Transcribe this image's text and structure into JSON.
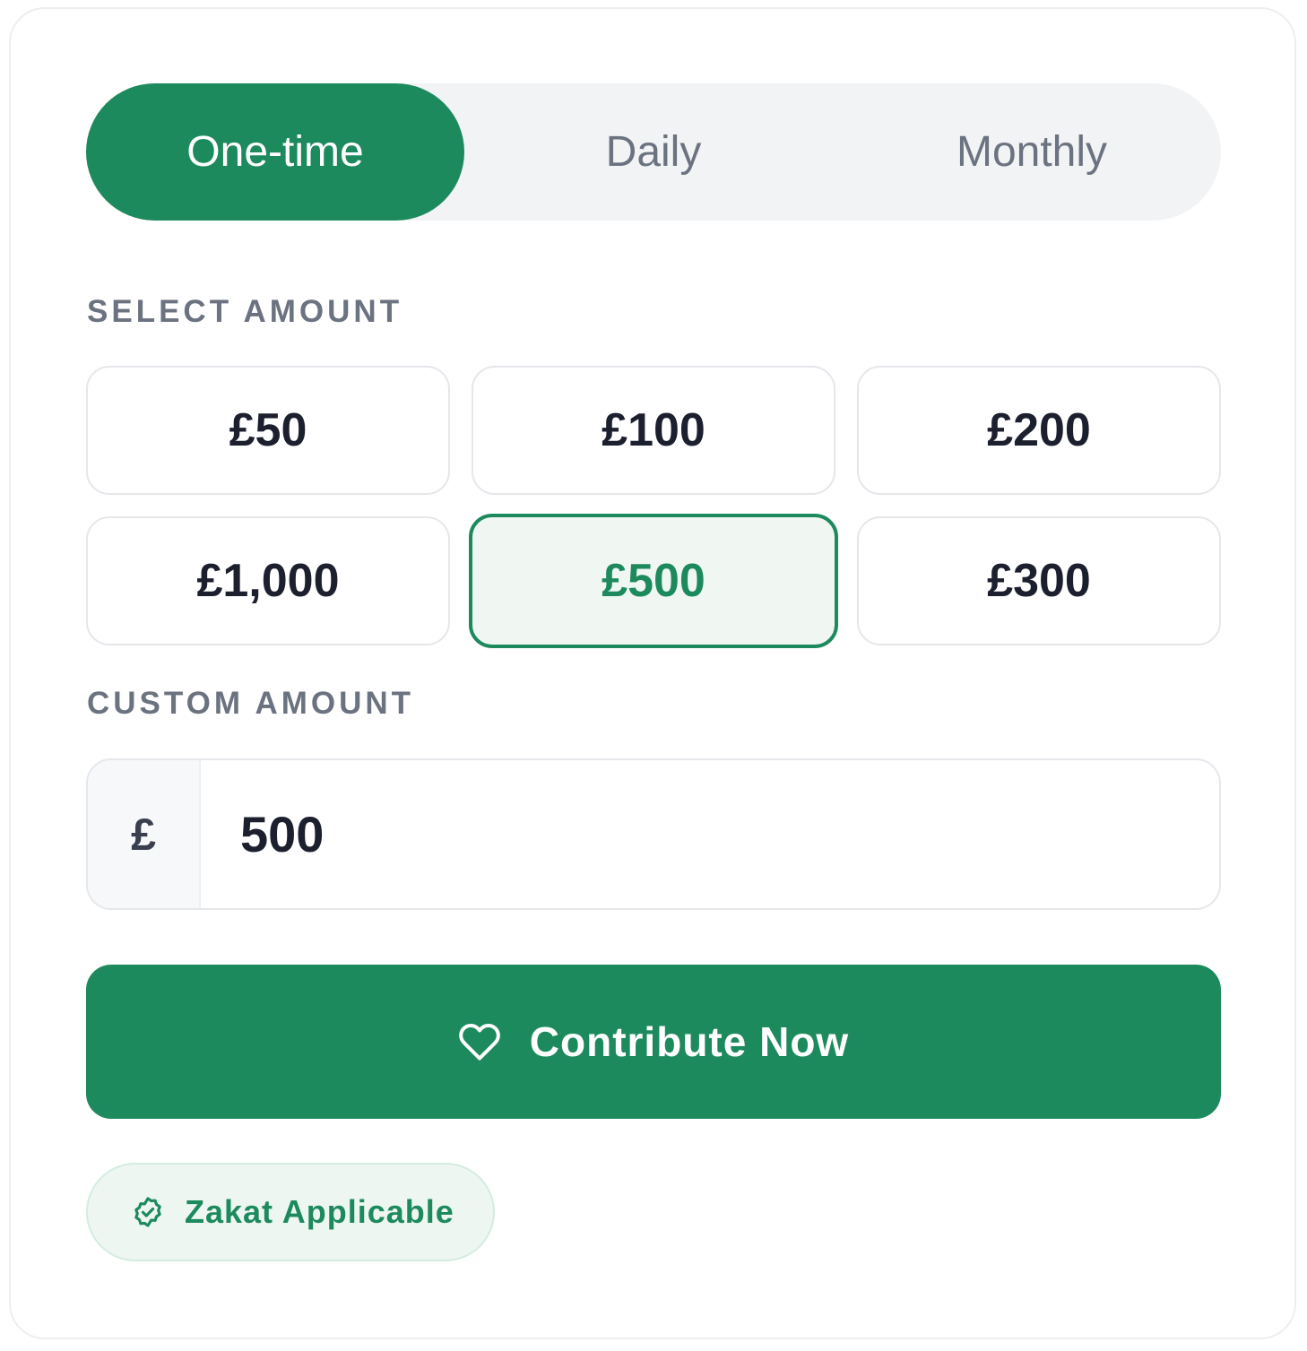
{
  "frequency": {
    "tabs": [
      {
        "label": "One-time",
        "active": true
      },
      {
        "label": "Daily",
        "active": false
      },
      {
        "label": "Monthly",
        "active": false
      }
    ]
  },
  "select_amount": {
    "label": "SELECT AMOUNT",
    "options": [
      {
        "label": "£50",
        "selected": false
      },
      {
        "label": "£100",
        "selected": false
      },
      {
        "label": "£200",
        "selected": false
      },
      {
        "label": "£1,000",
        "selected": false
      },
      {
        "label": "£500",
        "selected": true
      },
      {
        "label": "£300",
        "selected": false
      }
    ]
  },
  "custom_amount": {
    "label": "CUSTOM AMOUNT",
    "currency_symbol": "£",
    "value": "500"
  },
  "contribute_button": {
    "label": "Contribute Now",
    "icon": "heart-icon"
  },
  "zakat_badge": {
    "label": "Zakat Applicable",
    "icon": "badge-check-icon"
  },
  "colors": {
    "accent": "#1d8a5e",
    "selected_bg": "#f0f7f3",
    "badge_bg": "#eef6f2",
    "muted_text": "#6b7280",
    "dark_text": "#1c1f2e"
  }
}
